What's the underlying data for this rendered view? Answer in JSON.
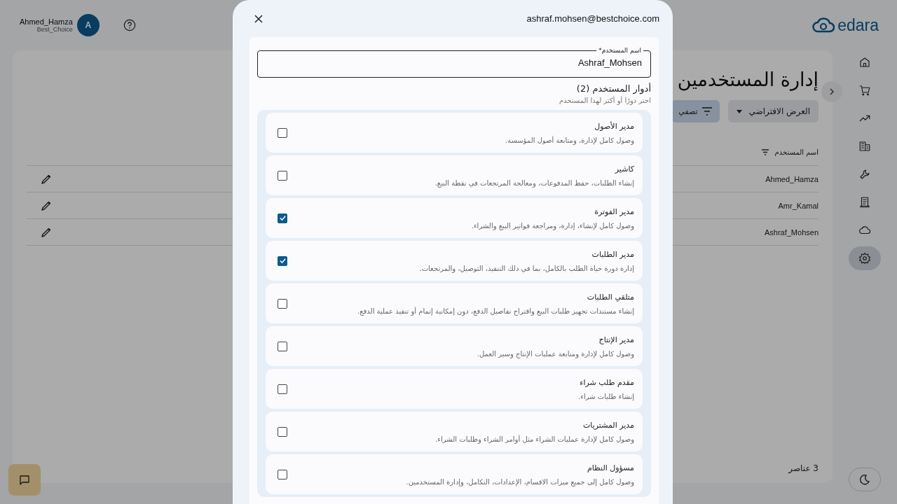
{
  "header": {
    "user_name": "Ahmed_Hamza",
    "company": "Best_Choice",
    "avatar_initial": "A",
    "logo_text": "edara"
  },
  "sidebar": {
    "items": [
      {
        "selected": false
      },
      {
        "selected": false
      },
      {
        "selected": false
      },
      {
        "selected": false
      },
      {
        "selected": false
      },
      {
        "selected": false
      },
      {
        "selected": false
      },
      {
        "selected": true
      }
    ]
  },
  "page": {
    "title": "إدارة المستخدمين",
    "view_button": "العرض الافتراضي",
    "filter_button": "تصفي",
    "table": {
      "columns": [
        "اسم المستخدم"
      ],
      "rows": [
        {
          "username": "Ahmed_Hamza"
        },
        {
          "username": "Amr_Kamal"
        },
        {
          "username": "Ashraf_Mohsen"
        }
      ]
    },
    "count": "3 عناصر"
  },
  "dialog": {
    "title": "ashraf.mohsen@bestchoice.com",
    "username_field": {
      "label": "اسم المستخدم",
      "required_mark": "*",
      "value": "Ashraf_Mohsen"
    },
    "roles_heading": "أدوار المستخدم (2)",
    "roles_hint": "اختر دورًا أو أكثر لهذا المستخدم",
    "roles": [
      {
        "name": "مدير الأصول",
        "description": "وصول كامل لإدارة، ومتابعة أصول المؤسسة.",
        "checked": false
      },
      {
        "name": "كاشير",
        "description": "إنشاء الطلبات، حفظ المدفوعات، ومعالجة المرتجعات في نقطة البيع.",
        "checked": false
      },
      {
        "name": "مدير الفوترة",
        "description": "وصول كامل لإنشاء، إدارة، ومراجعة فواتير البيع والشراء.",
        "checked": true
      },
      {
        "name": "مدير الطلبات",
        "description": "إدارة دورة حياة الطلب بالكامل، بما في ذلك التنفيذ، التوصيل، والمرتجعات.",
        "checked": true
      },
      {
        "name": "متلقي الطلبات",
        "description": "إنشاء مستندات تجهيز طلبات البيع واقتراح تفاصيل الدفع، دون إمكانية إتمام أو تنفيذ عملية الدفع.",
        "checked": false
      },
      {
        "name": "مدير الإنتاج",
        "description": "وصول كامل لإدارة ومتابعة عمليات الإنتاج وسير العمل.",
        "checked": false
      },
      {
        "name": "مقدم طلب شراء",
        "description": "إنشاء طلبات شراء.",
        "checked": false
      },
      {
        "name": "مدير المشتريات",
        "description": "وصول كامل لإدارة عمليات الشراء مثل أوامر الشراء وطلبات الشراء.",
        "checked": false
      },
      {
        "name": "مسؤول النظام",
        "description": "وصول كامل إلى جميع ميزات الاقسام، الإعدادات، التكامل، وإدارة المستخدمين.",
        "checked": false
      }
    ]
  }
}
